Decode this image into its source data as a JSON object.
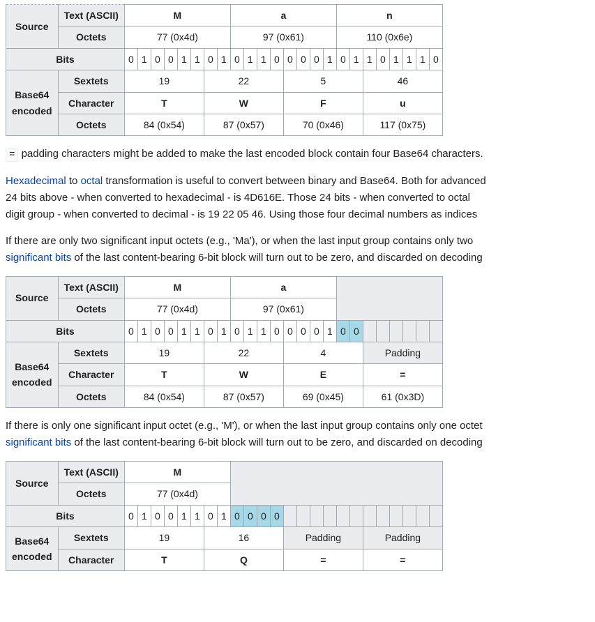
{
  "table1": {
    "headers": {
      "source": "Source",
      "text_ascii": "Text (ASCII)",
      "octets": "Octets",
      "bits": "Bits",
      "base64": "Base64\nencoded",
      "sextets": "Sextets",
      "character": "Character"
    },
    "source_chars": [
      "M",
      "a",
      "n"
    ],
    "source_octets": [
      "77 (0x4d)",
      "97 (0x61)",
      "110 (0x6e)"
    ],
    "bits": [
      "0",
      "1",
      "0",
      "0",
      "1",
      "1",
      "0",
      "1",
      "0",
      "1",
      "1",
      "0",
      "0",
      "0",
      "0",
      "1",
      "0",
      "1",
      "1",
      "0",
      "1",
      "1",
      "1",
      "0"
    ],
    "sextets": [
      "19",
      "22",
      "5",
      "46"
    ],
    "chars": [
      "T",
      "W",
      "F",
      "u"
    ],
    "enc_octets": [
      "84 (0x54)",
      "87 (0x57)",
      "70 (0x46)",
      "117 (0x75)"
    ]
  },
  "para1_prefix_code": "=",
  "para1_rest": " padding characters might be added to make the last encoded block contain four Base64 characters.",
  "para2_a": "Hexadecimal",
  "para2_b": " to ",
  "para2_c": "octal",
  "para2_d": " transformation is useful to convert between binary and Base64. Both for advanced",
  "para2_line2": "24 bits above - when converted to hexadecimal - is 4D616E. Those 24 bits - when converted to octal ",
  "para2_line3": "digit group - when converted to decimal - is 19 22 05 46. Using those four decimal numbers as indices",
  "para3_line1": "If there are only two significant input octets (e.g., 'Ma'), or when the last input group contains only two",
  "para3_link": "significant bits",
  "para3_rest": " of the last content-bearing 6-bit block will turn out to be zero, and discarded on decoding",
  "table2": {
    "source_chars": [
      "M",
      "a"
    ],
    "source_octets": [
      "77 (0x4d)",
      "97 (0x61)"
    ],
    "bits": [
      "0",
      "1",
      "0",
      "0",
      "1",
      "1",
      "0",
      "1",
      "0",
      "1",
      "1",
      "0",
      "0",
      "0",
      "0",
      "1"
    ],
    "bits_pad": [
      "0",
      "0"
    ],
    "sextets": [
      "19",
      "22",
      "4"
    ],
    "sextet_pad": "Padding",
    "chars": [
      "T",
      "W",
      "E",
      "="
    ],
    "enc_octets": [
      "84 (0x54)",
      "87 (0x57)",
      "69 (0x45)",
      "61 (0x3D)"
    ]
  },
  "para4_line1": "If there is only one significant input octet (e.g., 'M'), or when the last input group contains only one octet",
  "para4_link": "significant bits",
  "para4_rest": " of the last content-bearing 6-bit block will turn out to be zero, and discarded on decoding",
  "table3": {
    "source_chars": [
      "M"
    ],
    "source_octets": [
      "77 (0x4d)"
    ],
    "bits": [
      "0",
      "1",
      "0",
      "0",
      "1",
      "1",
      "0",
      "1"
    ],
    "bits_pad": [
      "0",
      "0",
      "0",
      "0"
    ],
    "sextets": [
      "19",
      "16"
    ],
    "sextet_pad": "Padding",
    "chars": [
      "T",
      "Q",
      "=",
      "="
    ]
  },
  "labels": {
    "source": "Source",
    "text_ascii": "Text (ASCII)",
    "octets": "Octets",
    "bits": "Bits",
    "base64_l1": "Base64",
    "base64_l2": "encoded",
    "sextets": "Sextets",
    "character": "Character"
  }
}
